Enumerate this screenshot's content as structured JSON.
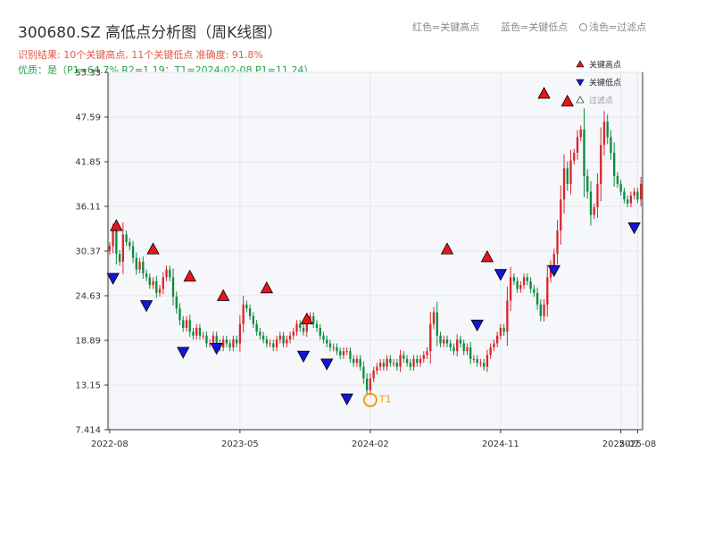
{
  "header": {
    "title": "300680.SZ 高低点分析图（周K线图）",
    "summary": "识别结果: 10个关键高点, 11个关键低点  准确度: 91.8%",
    "quality": "优质：是（P1=64.7%  R2=1.19；T1=2024-02-08 P1=11.24）"
  },
  "legend_hint": {
    "high": "红色=关键高点",
    "low": "蓝色=关键低点",
    "filtered": "浅色=过滤点"
  },
  "colors": {
    "up": "#d9262c",
    "down": "#0d8a3c",
    "high_marker": "#e8141b",
    "low_marker": "#1515d8",
    "plot_bg": "#f5f7fa",
    "t1": "#f39c12"
  },
  "chart_data": {
    "type": "candlestick",
    "title": "300680.SZ 高低点分析图（周K线图）",
    "ylim": [
      7.414,
      53.33
    ],
    "y_ticks": [
      "7.414",
      "13.15",
      "18.89",
      "24.63",
      "30.37",
      "36.11",
      "41.85",
      "47.59",
      "53.33"
    ],
    "x_ticks": [
      {
        "label": "2022-08",
        "week": 0
      },
      {
        "label": "2023-05",
        "week": 39
      },
      {
        "label": "2024-02",
        "week": 78
      },
      {
        "label": "2024-11",
        "week": 117
      },
      {
        "label": "2025-07",
        "week": 153
      },
      {
        "label": "2025-08",
        "week": 158
      }
    ],
    "legend": {
      "items": [
        "关键高点",
        "关键低点",
        "过滤点"
      ],
      "placement": "top-right"
    },
    "annotation": {
      "label": "T1",
      "date": "2024-02-08",
      "price": 11.24,
      "week": 78
    },
    "closes": [
      31.0,
      33.0,
      30.0,
      29.0,
      32.5,
      31.5,
      31.0,
      29.5,
      28.0,
      29.0,
      27.5,
      27.0,
      26.0,
      26.5,
      25.0,
      25.5,
      27.0,
      28.0,
      27.0,
      24.5,
      23.0,
      21.5,
      20.5,
      21.5,
      20.0,
      19.5,
      20.5,
      19.5,
      19.5,
      18.5,
      18.5,
      19.5,
      18.5,
      18.0,
      19.0,
      18.5,
      18.0,
      19.0,
      18.5,
      21.0,
      23.5,
      23.0,
      22.0,
      21.0,
      20.0,
      19.5,
      19.0,
      18.5,
      18.5,
      18.0,
      19.0,
      19.5,
      18.5,
      19.0,
      19.5,
      20.0,
      21.0,
      20.5,
      20.0,
      21.5,
      22.0,
      21.0,
      20.5,
      19.5,
      19.0,
      18.5,
      18.0,
      18.0,
      17.5,
      17.0,
      17.5,
      17.5,
      16.5,
      16.0,
      16.5,
      15.5,
      14.0,
      12.5,
      14.0,
      15.0,
      15.5,
      16.0,
      15.5,
      16.5,
      16.0,
      16.0,
      15.5,
      17.0,
      16.5,
      16.0,
      15.5,
      16.5,
      16.0,
      16.5,
      17.0,
      17.5,
      21.0,
      22.5,
      19.5,
      18.5,
      19.0,
      18.5,
      18.0,
      17.5,
      19.0,
      18.5,
      17.5,
      18.0,
      16.5,
      16.5,
      16.0,
      16.0,
      15.5,
      17.0,
      18.0,
      18.5,
      19.5,
      20.5,
      20.0,
      24.0,
      27.0,
      26.5,
      25.5,
      26.0,
      27.0,
      26.5,
      25.5,
      25.0,
      23.5,
      22.0,
      23.5,
      27.0,
      28.5,
      30.0,
      33.0,
      37.0,
      41.0,
      39.0,
      42.0,
      43.0,
      45.0,
      46.0,
      40.0,
      38.0,
      35.0,
      36.0,
      39.0,
      44.0,
      47.0,
      45.0,
      43.0,
      40.0,
      39.0,
      38.0,
      37.0,
      36.5,
      37.5,
      38.0,
      37.0,
      39.0
    ],
    "key_highs": [
      {
        "week": 2,
        "price": 33.0
      },
      {
        "week": 13,
        "price": 30.0
      },
      {
        "week": 24,
        "price": 26.5
      },
      {
        "week": 34,
        "price": 24.0
      },
      {
        "week": 47,
        "price": 25.0
      },
      {
        "week": 59,
        "price": 21.0
      },
      {
        "week": 101,
        "price": 30.0
      },
      {
        "week": 113,
        "price": 29.0
      },
      {
        "week": 130,
        "price": 50.0
      },
      {
        "week": 137,
        "price": 49.0
      }
    ],
    "key_lows": [
      {
        "week": 1,
        "price": 27.5
      },
      {
        "week": 11,
        "price": 24.0
      },
      {
        "week": 22,
        "price": 18.0
      },
      {
        "week": 32,
        "price": 18.5
      },
      {
        "week": 58,
        "price": 17.5
      },
      {
        "week": 65,
        "price": 16.5
      },
      {
        "week": 71,
        "price": 12.0
      },
      {
        "week": 110,
        "price": 21.5
      },
      {
        "week": 117,
        "price": 28.0
      },
      {
        "week": 133,
        "price": 28.5
      },
      {
        "week": 157,
        "price": 34.0
      }
    ]
  }
}
